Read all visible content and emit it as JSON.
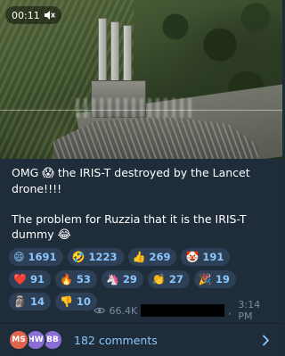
{
  "video": {
    "duration": "00:11",
    "muted": true
  },
  "post": {
    "line1_before": "OMG",
    "line1_emoji": "😱",
    "line1_after": " the IRIS-T destroyed by the Lancet drone!!!!",
    "line2_text": "The problem for Ruzzia that it is the IRIS-T dummy",
    "line2_emoji": "😂"
  },
  "reactions": [
    {
      "emoji": "😄",
      "count": "1691"
    },
    {
      "emoji": "🤣",
      "count": "1223"
    },
    {
      "emoji": "👍",
      "count": "269"
    },
    {
      "emoji": "🤡",
      "count": "191"
    },
    {
      "emoji": "❤️",
      "count": "91"
    },
    {
      "emoji": "🔥",
      "count": "53"
    },
    {
      "emoji": "🦄",
      "count": "29"
    },
    {
      "emoji": "👏",
      "count": "27"
    },
    {
      "emoji": "🎉",
      "count": "19"
    },
    {
      "emoji": "🗿",
      "count": "14"
    },
    {
      "emoji": "👎",
      "count": "10"
    }
  ],
  "meta": {
    "views": "66.4K",
    "time_prefix": ", ",
    "time": "3:14 PM"
  },
  "comments": {
    "avatars": [
      {
        "initials": "MS",
        "color": "#e0654f"
      },
      {
        "initials": "HW",
        "color": "#8a6ed6"
      },
      {
        "initials": "BB",
        "color": "#8a6ed6"
      }
    ],
    "label": "182 comments"
  },
  "colors": {
    "accent": "#8ac6ff",
    "background": "#1f2d3b",
    "reaction_bg": "#2e4055",
    "muted_text": "#7b8b9c"
  }
}
